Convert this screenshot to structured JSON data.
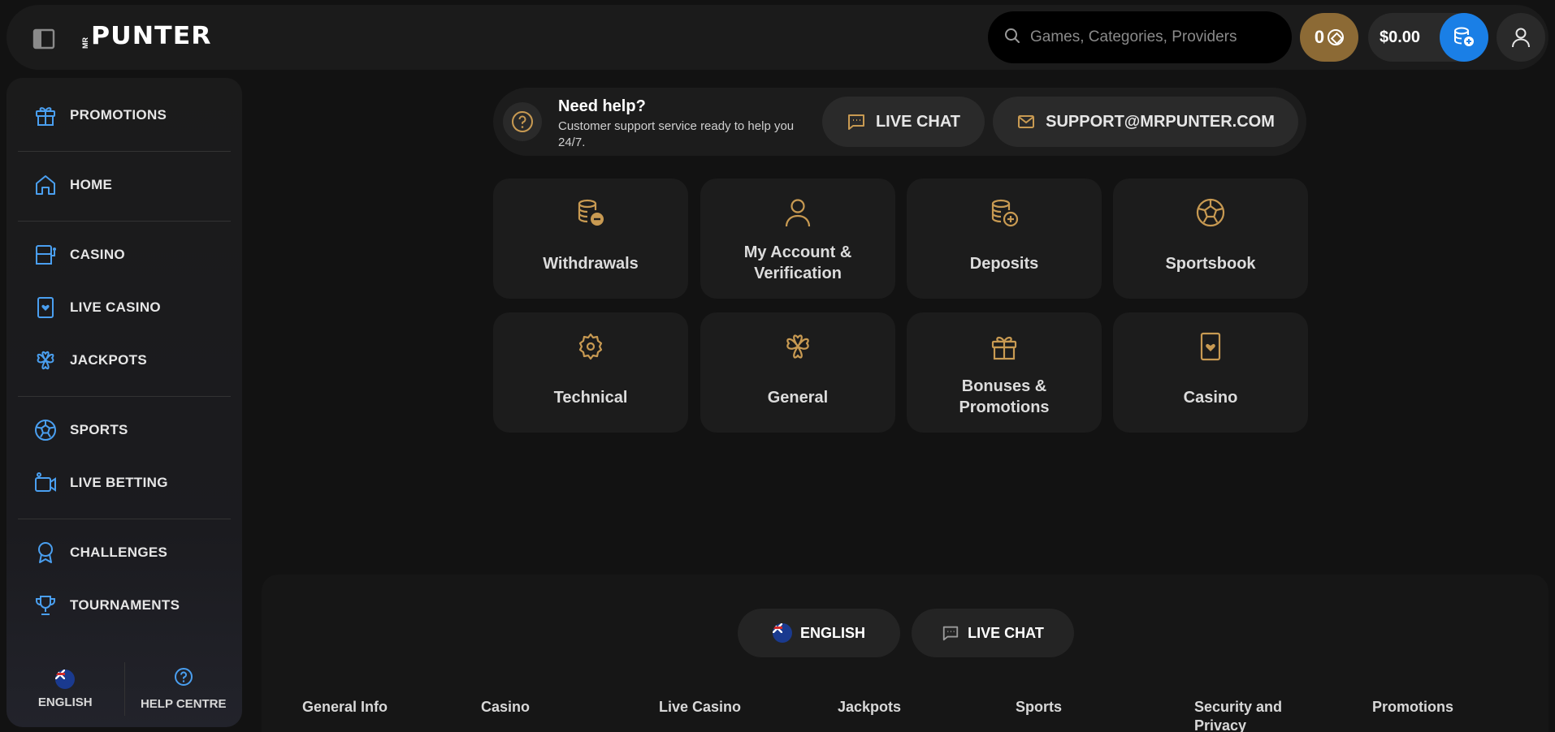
{
  "header": {
    "logo_small": "MR",
    "logo_text": "PUNTER",
    "search_placeholder": "Games, Categories, Providers",
    "coins": "0",
    "balance": "$0.00"
  },
  "sidebar": {
    "items": [
      {
        "label": "PROMOTIONS",
        "icon": "gift-icon"
      },
      {
        "label": "HOME",
        "icon": "home-icon"
      },
      {
        "label": "CASINO",
        "icon": "slot-machine-icon"
      },
      {
        "label": "LIVE CASINO",
        "icon": "card-heart-icon"
      },
      {
        "label": "JACKPOTS",
        "icon": "clover-icon"
      },
      {
        "label": "SPORTS",
        "icon": "soccer-ball-icon"
      },
      {
        "label": "LIVE BETTING",
        "icon": "video-camera-icon"
      },
      {
        "label": "CHALLENGES",
        "icon": "medal-icon"
      },
      {
        "label": "TOURNAMENTS",
        "icon": "trophy-icon"
      }
    ],
    "bottom": {
      "language": "ENGLISH",
      "help": "HELP CENTRE"
    }
  },
  "help": {
    "title": "Need help?",
    "subtitle": "Customer support service ready to help you 24/7.",
    "live_chat": "LIVE CHAT",
    "email": "SUPPORT@MRPUNTER.COM"
  },
  "categories": [
    {
      "label": "Withdrawals",
      "icon": "coins-minus-icon"
    },
    {
      "label": "My Account & Verification",
      "icon": "user-icon"
    },
    {
      "label": "Deposits",
      "icon": "coins-plus-icon"
    },
    {
      "label": "Sportsbook",
      "icon": "soccer-ball-icon"
    },
    {
      "label": "Technical",
      "icon": "gear-icon"
    },
    {
      "label": "General",
      "icon": "clover-icon"
    },
    {
      "label": "Bonuses & Promotions",
      "icon": "gift-icon"
    },
    {
      "label": "Casino",
      "icon": "card-heart-icon"
    }
  ],
  "footer": {
    "language": "ENGLISH",
    "live_chat": "LIVE CHAT",
    "columns": [
      "General Info",
      "Casino",
      "Live Casino",
      "Jackpots",
      "Sports",
      "Security and Privacy",
      "Promotions"
    ]
  },
  "colors": {
    "accent_gold": "#c89a52",
    "accent_blue": "#4a9ff0",
    "deposit_blue": "#1a7fe6",
    "coins_bg": "#8c6a35"
  }
}
